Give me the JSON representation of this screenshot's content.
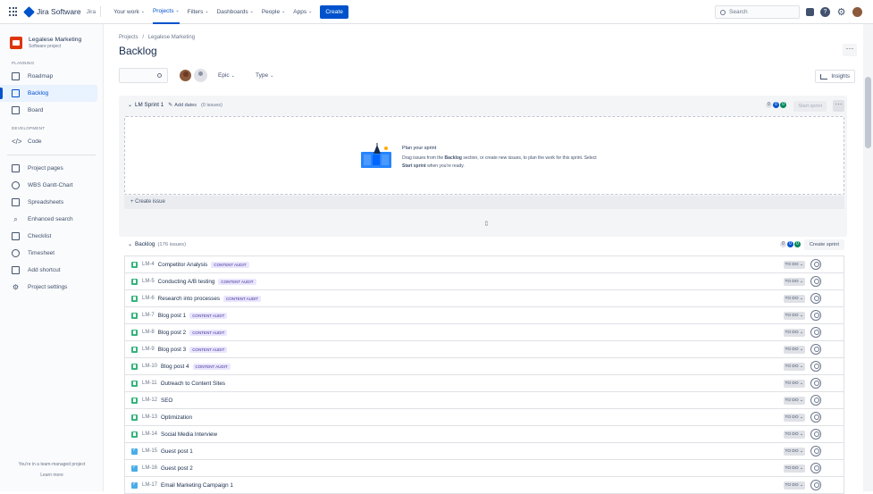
{
  "topnav": {
    "product": "Jira Software",
    "jira_label": "Jira",
    "items": [
      {
        "label": "Your work",
        "active": false
      },
      {
        "label": "Projects",
        "active": true
      },
      {
        "label": "Filters",
        "active": false
      },
      {
        "label": "Dashboards",
        "active": false
      },
      {
        "label": "People",
        "active": false
      },
      {
        "label": "Apps",
        "active": false
      }
    ],
    "create_label": "Create",
    "search_placeholder": "Search",
    "accent_color": "#0052cc"
  },
  "sidebar": {
    "project_name": "Legalese Marketing",
    "project_type": "Software project",
    "planning_title": "PLANNING",
    "planning_items": [
      {
        "label": "Roadmap",
        "icon": "roadmap-icon"
      },
      {
        "label": "Backlog",
        "icon": "backlog-icon",
        "active": true
      },
      {
        "label": "Board",
        "icon": "board-icon"
      }
    ],
    "development_title": "DEVELOPMENT",
    "development_items": [
      {
        "label": "Code",
        "icon": "code-icon"
      }
    ],
    "extra_items": [
      {
        "label": "Project pages",
        "icon": "pages-icon"
      },
      {
        "label": "WBS Gantt-Chart",
        "icon": "gantt-icon"
      },
      {
        "label": "Spreadsheets",
        "icon": "spreadsheet-icon"
      },
      {
        "label": "Enhanced search",
        "icon": "enhanced-search-icon"
      },
      {
        "label": "Checklist",
        "icon": "checklist-icon"
      },
      {
        "label": "Timesheet",
        "icon": "timesheet-icon"
      },
      {
        "label": "Add shortcut",
        "icon": "add-shortcut-icon"
      },
      {
        "label": "Project settings",
        "icon": "settings-icon"
      }
    ],
    "footer_text": "You're in a team-managed project",
    "footer_link": "Learn more"
  },
  "main": {
    "breadcrumb_root": "Projects",
    "breadcrumb_sep": "/",
    "breadcrumb_project": "Legalese Marketing",
    "title": "Backlog",
    "filter_type": "Type",
    "filter_epic": "Epic",
    "insights_label": "Insights"
  },
  "sprint": {
    "name": "LM Sprint 1",
    "add_dates": "Add dates",
    "issue_count": "(0 issues)",
    "badges": [
      "0",
      "0",
      "0"
    ],
    "start_label": "Start sprint",
    "empty_title": "Plan your sprint",
    "empty_text_1": "Drag issues from the",
    "empty_text_bold1": "Backlog",
    "empty_text_2": "section, or create new issues, to plan the work for this sprint. Select",
    "empty_text_bold2": "Start sprint",
    "empty_text_3": "when you're ready.",
    "create_issue_label": "+ Create issue"
  },
  "backlog": {
    "title": "Backlog",
    "count": "(176 issues)",
    "badges": [
      "0",
      "0",
      "0"
    ],
    "create_sprint_label": "Create sprint",
    "issues": [
      {
        "type": "story",
        "key": "LM-4",
        "summary": "Competitor Analysis",
        "epic": "CONTENT AUDIT",
        "status": "TO DO"
      },
      {
        "type": "story",
        "key": "LM-5",
        "summary": "Conducting A/B testing",
        "epic": "CONTENT AUDIT",
        "status": "TO DO"
      },
      {
        "type": "story",
        "key": "LM-6",
        "summary": "Research into processes",
        "epic": "CONTENT AUDIT",
        "status": "TO DO"
      },
      {
        "type": "story",
        "key": "LM-7",
        "summary": "Blog post 1",
        "epic": "CONTENT AUDIT",
        "status": "TO DO"
      },
      {
        "type": "story",
        "key": "LM-8",
        "summary": "Blog post 2",
        "epic": "CONTENT AUDIT",
        "status": "TO DO"
      },
      {
        "type": "story",
        "key": "LM-9",
        "summary": "Blog post 3",
        "epic": "CONTENT AUDIT",
        "status": "TO DO"
      },
      {
        "type": "story",
        "key": "LM-10",
        "summary": "Blog post 4",
        "epic": "CONTENT AUDIT",
        "status": "TO DO"
      },
      {
        "type": "story",
        "key": "LM-11",
        "summary": "Outreach to Content Sites",
        "epic": "",
        "status": "TO DO"
      },
      {
        "type": "story",
        "key": "LM-12",
        "summary": "SEO",
        "epic": "",
        "status": "TO DO"
      },
      {
        "type": "story",
        "key": "LM-13",
        "summary": "Optimization",
        "epic": "",
        "status": "TO DO"
      },
      {
        "type": "story",
        "key": "LM-14",
        "summary": "Social Media Interview",
        "epic": "",
        "status": "TO DO"
      },
      {
        "type": "task",
        "key": "LM-15",
        "summary": "Guest post 1",
        "epic": "",
        "status": "TO DO"
      },
      {
        "type": "task",
        "key": "LM-16",
        "summary": "Guest post 2",
        "epic": "",
        "status": "TO DO"
      },
      {
        "type": "task",
        "key": "LM-17",
        "summary": "Email Marketing Campaign 1",
        "epic": "",
        "status": "TO DO"
      }
    ]
  }
}
